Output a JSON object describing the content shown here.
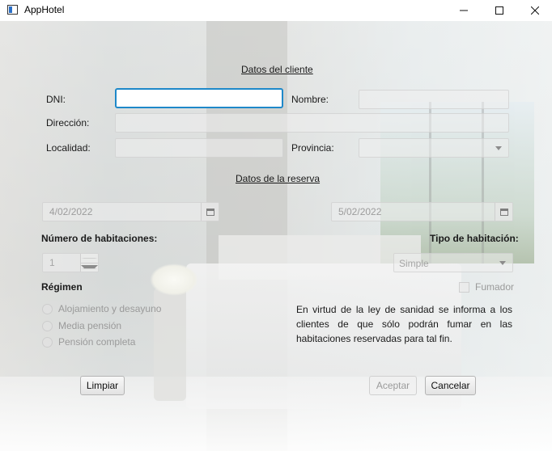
{
  "window": {
    "title": "AppHotel"
  },
  "client_section": {
    "title": "Datos del cliente",
    "dni_label": "DNI:",
    "dni_value": "",
    "nombre_label": "Nombre:",
    "nombre_value": "",
    "direccion_label": "Dirección:",
    "direccion_value": "",
    "localidad_label": "Localidad:",
    "localidad_value": "",
    "provincia_label": "Provincia:",
    "provincia_value": ""
  },
  "reservation_section": {
    "title": "Datos de la reserva",
    "check_in_date": "4/02/2022",
    "check_out_date": "5/02/2022",
    "rooms_label": "Número de habitaciones:",
    "rooms_value": "1",
    "room_type_label": "Tipo de habitación:",
    "room_type_value": "Simple",
    "regimen_label": "Régimen",
    "regimen_options": [
      "Alojamiento y desayuno",
      "Media pensión",
      "Pensión completa"
    ],
    "smoker_label": "Fumador",
    "info_text": "En virtud de la ley de sanidad se informa a los clientes de que sólo podrán fumar en las habitaciones reservadas para tal fin."
  },
  "buttons": {
    "clear": "Limpiar",
    "accept": "Aceptar",
    "cancel": "Cancelar"
  },
  "colors": {
    "focus_border": "#1e88c9"
  }
}
